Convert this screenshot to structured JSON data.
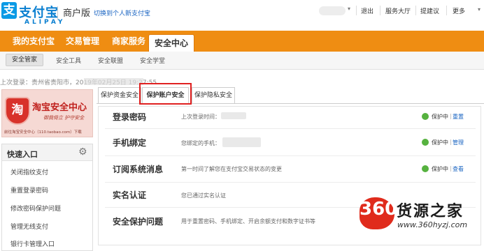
{
  "header": {
    "logo_glyph": "支",
    "logo_text": "支付宝",
    "logo_sub": "ALIPAY",
    "merchant_label": "商户版",
    "switch_link": "切换到个人新支付宝",
    "top_links": {
      "logout": "退出",
      "service": "服务大厅",
      "feedback": "提建议",
      "more": "更多"
    }
  },
  "nav": {
    "items": [
      "我的支付宝",
      "交易管理",
      "商家服务"
    ],
    "active": "安全中心"
  },
  "subnav": {
    "active": "安全管家",
    "items": [
      "安全工具",
      "安全联盟",
      "安全学堂"
    ]
  },
  "last_login": "上次登录：贵州省贵阳市，2019年02月25日 19:27:55",
  "banner": {
    "icon_glyph": "淘",
    "title": "淘宝安全中心",
    "slogan": "御我倚立 护守安全",
    "footer": "前往淘宝安全中心（110.taobao.com）下载"
  },
  "quick_links": {
    "title": "快速入口",
    "items": [
      "关闭指纹支付",
      "重置登录密码",
      "修改密码保护问题",
      "管理无线支付",
      "银行卡管理入口"
    ]
  },
  "tabs": [
    "保护资金安全",
    "保护账户安全",
    "保护隐私安全"
  ],
  "security_rows": [
    {
      "title": "登录密码",
      "desc": "上次登录时间：",
      "status": "保护中",
      "actions": [
        "重置"
      ]
    },
    {
      "title": "手机绑定",
      "desc": "您绑定的手机：",
      "status": "保护中",
      "actions": [
        "管理"
      ]
    },
    {
      "title": "订阅系统消息",
      "desc": "第一时间了解您在支付宝交易状态的变更",
      "status": "保护中",
      "actions": [
        "查看"
      ]
    },
    {
      "title": "实名认证",
      "desc": "您已通过实名认证",
      "status": "",
      "actions": []
    },
    {
      "title": "安全保护问题",
      "desc": "用于重置密码、手机绑定、开启余额支付和数字证书等",
      "status": "",
      "actions": []
    }
  ],
  "watermark": {
    "logo": "360",
    "name": "货源之家",
    "url": "www.360hyzj.com"
  }
}
